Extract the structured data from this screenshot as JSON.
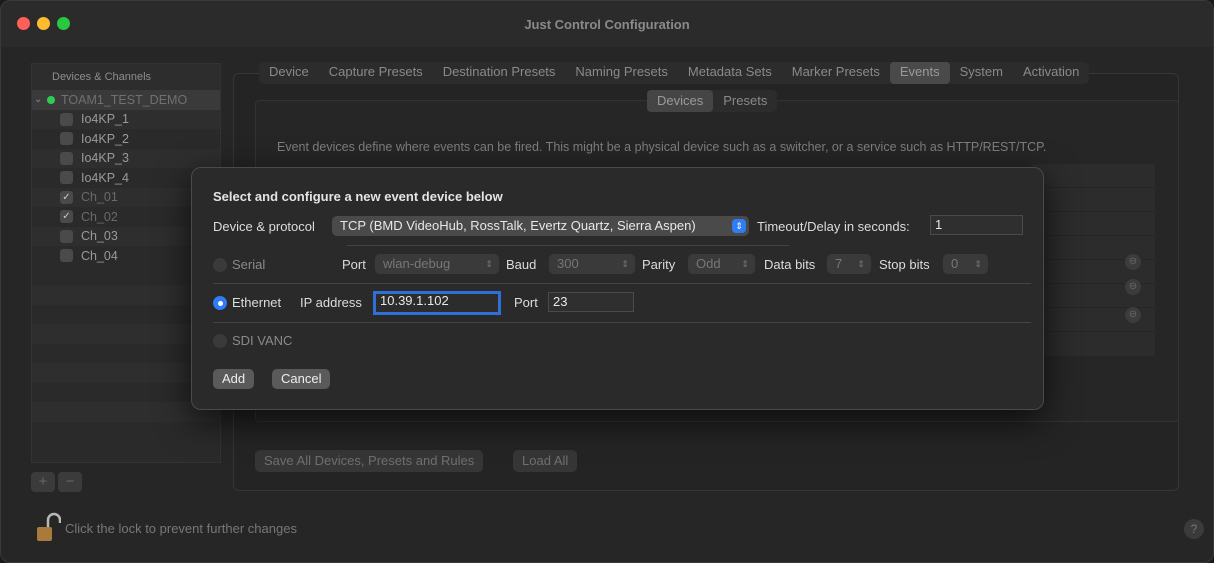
{
  "window": {
    "title": "Just Control Configuration"
  },
  "sidebar": {
    "header": "Devices & Channels",
    "root": "TOAM1_TEST_DEMO",
    "items": [
      {
        "label": "Io4KP_1",
        "checked": false,
        "dim": false
      },
      {
        "label": "Io4KP_2",
        "checked": false,
        "dim": false
      },
      {
        "label": "Io4KP_3",
        "checked": false,
        "dim": false
      },
      {
        "label": "Io4KP_4",
        "checked": false,
        "dim": false
      },
      {
        "label": "Ch_01",
        "checked": true,
        "dim": true
      },
      {
        "label": "Ch_02",
        "checked": true,
        "dim": true
      },
      {
        "label": "Ch_03",
        "checked": false,
        "dim": false
      },
      {
        "label": "Ch_04",
        "checked": false,
        "dim": false
      }
    ],
    "add_label": "+",
    "remove_label": "−"
  },
  "tabs": [
    "Device",
    "Capture Presets",
    "Destination Presets",
    "Naming Presets",
    "Metadata Sets",
    "Marker Presets",
    "Events",
    "System",
    "Activation"
  ],
  "active_tab": "Events",
  "subtabs": [
    "Devices",
    "Presets"
  ],
  "active_subtab": "Devices",
  "description": "Event devices define where events can be fired. This might be a physical device such as a switcher, or a service such as HTTP/REST/TCP.",
  "buttons": {
    "save_all": "Save All Devices, Presets and Rules",
    "load_all": "Load All"
  },
  "footer": {
    "lock_text": "Click the lock to prevent further changes",
    "help": "?"
  },
  "dialog": {
    "heading": "Select and configure a new event device below",
    "device_protocol_label": "Device & protocol",
    "device_protocol_value": "TCP (BMD VideoHub, RossTalk, Evertz Quartz, Sierra Aspen)",
    "timeout_label": "Timeout/Delay in seconds:",
    "timeout_value": "1",
    "serial": {
      "label": "Serial",
      "port_label": "Port",
      "port_value": "wlan-debug",
      "baud_label": "Baud",
      "baud_value": "300",
      "parity_label": "Parity",
      "parity_value": "Odd",
      "databits_label": "Data bits",
      "databits_value": "7",
      "stopbits_label": "Stop bits",
      "stopbits_value": "0"
    },
    "ethernet": {
      "label": "Ethernet",
      "ip_label": "IP address",
      "ip_value": "10.39.1.102",
      "port_label": "Port",
      "port_value": "23"
    },
    "sdi": {
      "label": "SDI VANC"
    },
    "add_label": "Add",
    "cancel_label": "Cancel"
  },
  "colors": {
    "accent": "#2f7cf6",
    "green": "#2fcc55"
  }
}
